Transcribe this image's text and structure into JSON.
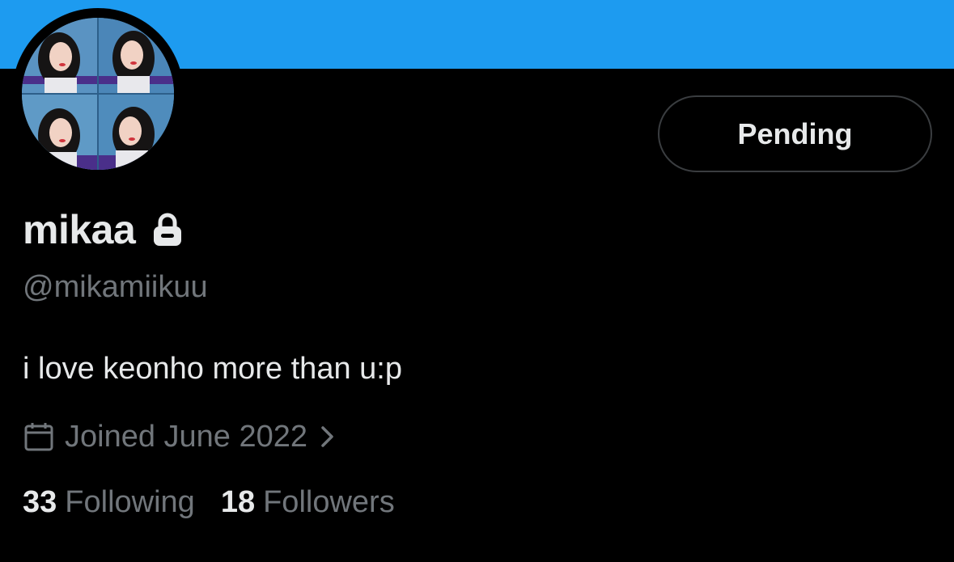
{
  "colors": {
    "banner": "#1d9bf0",
    "background": "#000000",
    "text_primary": "#e7e9ea",
    "text_secondary": "#71767b",
    "button_border": "#3a3d40"
  },
  "profile": {
    "display_name": "mikaa",
    "handle": "@mikamiikuu",
    "bio": "i love keonho more than u:p",
    "joined": "Joined June 2022",
    "protected_icon": "lock-icon"
  },
  "actions": {
    "follow_status_label": "Pending"
  },
  "stats": {
    "following_count": "33",
    "following_label": "Following",
    "followers_count": "18",
    "followers_label": "Followers"
  }
}
